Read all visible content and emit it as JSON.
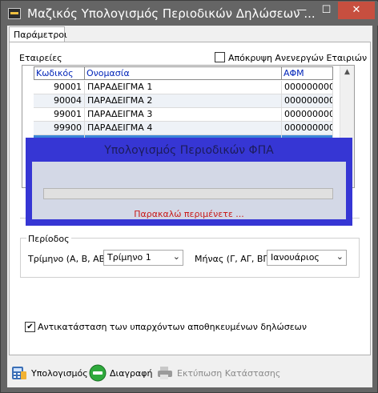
{
  "window": {
    "title": "Μαζικός Υπολογισμός Περιοδικών Δηλώσεων ...",
    "minimize": "—",
    "maximize": "☐",
    "close": "✕"
  },
  "tab": {
    "label": "Παράμετροι"
  },
  "companies": {
    "label": "Εταιρείες",
    "hide_inactive_label": "Απόκρυψη Ανενεργών Εταιριών",
    "hide_inactive_checked": false,
    "columns": [
      "Κωδικός",
      "Ονομασία",
      "ΑΦΜ"
    ],
    "rows": [
      {
        "code": "90001",
        "name": "ΠΑΡΑΔΕΙΓΜΑ 1",
        "afm": "000000000"
      },
      {
        "code": "90004",
        "name": "ΠΑΡΑΔΕΙΓΜΑ 2",
        "afm": "000000000"
      },
      {
        "code": "99001",
        "name": "ΠΑΡΑΔΕΙΓΜΑ 3",
        "afm": "000000000"
      },
      {
        "code": "99900",
        "name": "ΠΑΡΑΔΕΙΓΜΑ 4",
        "afm": "000000000"
      }
    ]
  },
  "period": {
    "label": "Περίοδος",
    "quarter_label": "Τρίμηνο (Α, Β, ΑΒ)",
    "quarter_value": "Τρίμηνο 1",
    "month_label": "Μήνας (Γ, ΑΓ, ΒΓ)",
    "month_value": "Ιανουάριος"
  },
  "replace": {
    "label": "Αντικατάσταση των υπαρχόντων αποθηκευμένων δηλώσεων",
    "checked": true,
    "check_glyph": "✔"
  },
  "toolbar": {
    "calculate": "Υπολογισμός",
    "delete": "Διαγραφή",
    "print": "Εκτύπωση Κατάστασης"
  },
  "progress": {
    "title": "Υπολογισμός Περιοδικών ΦΠΑ",
    "message": "Παρακαλώ περιμένετε ...",
    "fraction": 0
  },
  "colors": {
    "overlay": "#3636d4",
    "header_text": "#0024b8",
    "selection": "#3a86d8",
    "message": "#c81a1a"
  }
}
